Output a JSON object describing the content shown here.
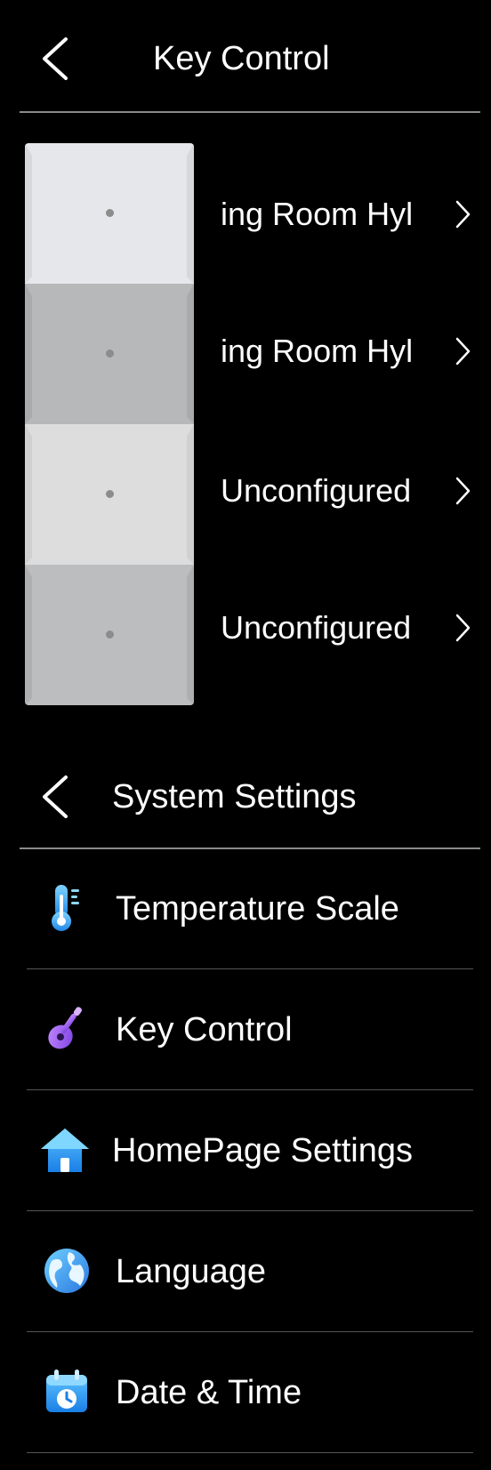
{
  "key_control_header": {
    "title": "Key Control"
  },
  "keys": [
    {
      "label": "ing Room Hyl"
    },
    {
      "label": "ing Room Hyl"
    },
    {
      "label": "Unconfigured"
    },
    {
      "label": "Unconfigured"
    }
  ],
  "system_settings_header": {
    "title": "System Settings"
  },
  "settings_items": [
    {
      "label": "Temperature Scale",
      "icon": "thermometer-icon"
    },
    {
      "label": "Key Control",
      "icon": "guitar-icon"
    },
    {
      "label": "HomePage Settings",
      "icon": "home-icon"
    },
    {
      "label": "Language",
      "icon": "globe-icon"
    },
    {
      "label": "Date & Time",
      "icon": "calendar-clock-icon"
    }
  ],
  "colors": {
    "background": "#000000",
    "text": "#ffffff",
    "divider": "#8a8a8a",
    "key_light": "#e4e6e9",
    "key_dark": "#b8b9bb"
  }
}
